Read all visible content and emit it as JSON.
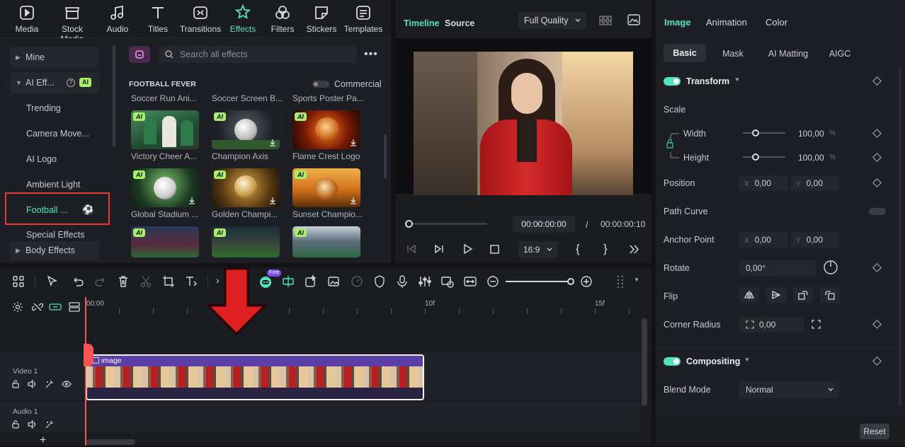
{
  "toolbar": {
    "items": [
      {
        "label": "Media",
        "icon": "media-icon"
      },
      {
        "label": "Stock Media",
        "icon": "stock-media-icon"
      },
      {
        "label": "Audio",
        "icon": "audio-icon"
      },
      {
        "label": "Titles",
        "icon": "titles-icon"
      },
      {
        "label": "Transitions",
        "icon": "transitions-icon"
      },
      {
        "label": "Effects",
        "icon": "effects-icon",
        "active": true
      },
      {
        "label": "Filters",
        "icon": "filters-icon"
      },
      {
        "label": "Stickers",
        "icon": "stickers-icon"
      },
      {
        "label": "Templates",
        "icon": "templates-icon"
      }
    ]
  },
  "sidebar": {
    "mine": "Mine",
    "ai_effects": "AI Eff...",
    "ai_badge": "AI",
    "items": [
      "Trending",
      "Camera Move...",
      "AI Logo",
      "Ambient Light",
      "Football ...",
      "Special Effects"
    ],
    "body_effects": "Body Effects"
  },
  "effects": {
    "search_placeholder": "Search all effects",
    "section_title": "FOOTBALL FEVER",
    "commercial_label": "Commercial",
    "ai_badge": "AI",
    "top_captions": [
      "Soccer Run Ani...",
      "Soccer Screen B...",
      "Sports Poster Pa..."
    ],
    "row1": [
      "Victory Cheer A...",
      "Champion Axis",
      "Flame Crest Logo"
    ],
    "row2": [
      "Global Stadium ...",
      "Golden Champi...",
      "Sunset Champio..."
    ]
  },
  "preview": {
    "tab_timeline": "Timeline",
    "tab_source": "Source",
    "quality": "Full Quality",
    "current_time": "00:00:00:00",
    "separator": "/",
    "total_time": "00:00:00:10",
    "aspect": "16:9"
  },
  "props": {
    "tabs": [
      "Image",
      "Animation",
      "Color"
    ],
    "subtabs": [
      "Basic",
      "Mask",
      "AI Matting",
      "AIGC"
    ],
    "transform": "Transform",
    "scale": "Scale",
    "width_label": "Width",
    "width_value": "100,00",
    "height_label": "Height",
    "height_value": "100,00",
    "percent": "%",
    "position": "Position",
    "pos_x_prefix": "X",
    "pos_x": "0,00",
    "pos_y_prefix": "Y",
    "pos_y": "0,00",
    "path_curve": "Path Curve",
    "anchor": "Anchor Point",
    "anchor_x": "0,00",
    "anchor_y": "0,00",
    "rotate": "Rotate",
    "rotate_value": "0,00°",
    "flip": "Flip",
    "corner_radius": "Corner Radius",
    "corner_value": "0,00",
    "compositing": "Compositing",
    "blend_mode": "Blend Mode",
    "blend_value": "Normal",
    "reset": "Reset"
  },
  "timeline": {
    "free_badge": "Free",
    "ruler": [
      "00:00",
      "10f",
      "15f"
    ],
    "video_track": "Video 1",
    "audio_track": "Audio 1",
    "clip_label": "image",
    "add": "+"
  },
  "colors": {
    "accent": "#4fe3c1",
    "ai_badge": "#a8f06a",
    "clip": "#5b3fa6",
    "arrow": "#e02020",
    "highlight": "#e53935"
  }
}
